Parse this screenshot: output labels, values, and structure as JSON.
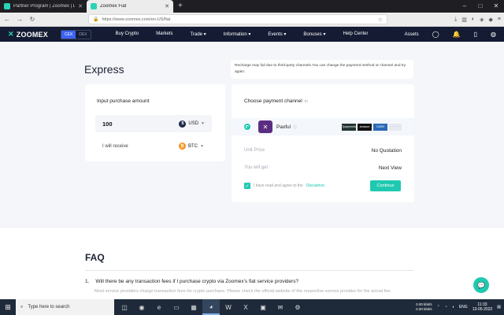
{
  "browser": {
    "tabs": [
      {
        "title": "Partner Program | Zoomex | Lo",
        "active": false,
        "favicon_color": "#29d3b7"
      },
      {
        "title": "Zoomex Fiat",
        "active": true,
        "favicon_color": "#29d3b7"
      }
    ],
    "new_tab_label": "+",
    "url": "https://www.zoomex.com/en-US/fiat"
  },
  "header": {
    "logo": "ZOOMEX",
    "toggle": [
      "CEX",
      "DEX"
    ],
    "menu": [
      "Buy Crypto",
      "Markets",
      "Trade ▾",
      "Information ▾",
      "Events ▾",
      "Bonuses ▾",
      "Help Center"
    ],
    "assets_label": "Assets"
  },
  "express": {
    "title": "Express",
    "notice": "Recharge may fail due to third-party channels.You can change the payment method or channel and try again.",
    "input_label": "Input purchase amount",
    "amount": "100",
    "pay_currency": "USD",
    "receive_label": "I will receive",
    "receive_currency": "BTC"
  },
  "payment": {
    "title": "Choose payment channel",
    "title_sub": "to",
    "provider_name": "Paxful",
    "methods": [
      "Tpayments",
      "amazon",
      "CARD"
    ],
    "more": "· · ·",
    "unit_price_label": "Unit Price",
    "unit_price_value": "No Quotation",
    "you_get_label": "You will get",
    "you_get_value": "Next View",
    "agree_text": "I have read and agree to the",
    "disclaimer_link": "Disclaimer.",
    "continue_label": "Continue"
  },
  "faq": {
    "title": "FAQ",
    "q1_num": "1.",
    "q1": "Will there be any transaction fees if I purchase crypto via Zoomex's fiat service providers?",
    "a1": "Most service providers charge transaction fees for crypto purchase. Please check the official website of the respective service provider for the actual fee."
  },
  "taskbar": {
    "search_placeholder": "Type here to search",
    "net_up": "0.00 kbit/s",
    "net_down": "0.00 kbit/s",
    "lang": "ENG",
    "time": "11:33",
    "date": "13-05-2022"
  },
  "colors": {
    "accent": "#1fc9b0",
    "header_bg": "#141b33",
    "page_bg": "#f4f6f9"
  }
}
